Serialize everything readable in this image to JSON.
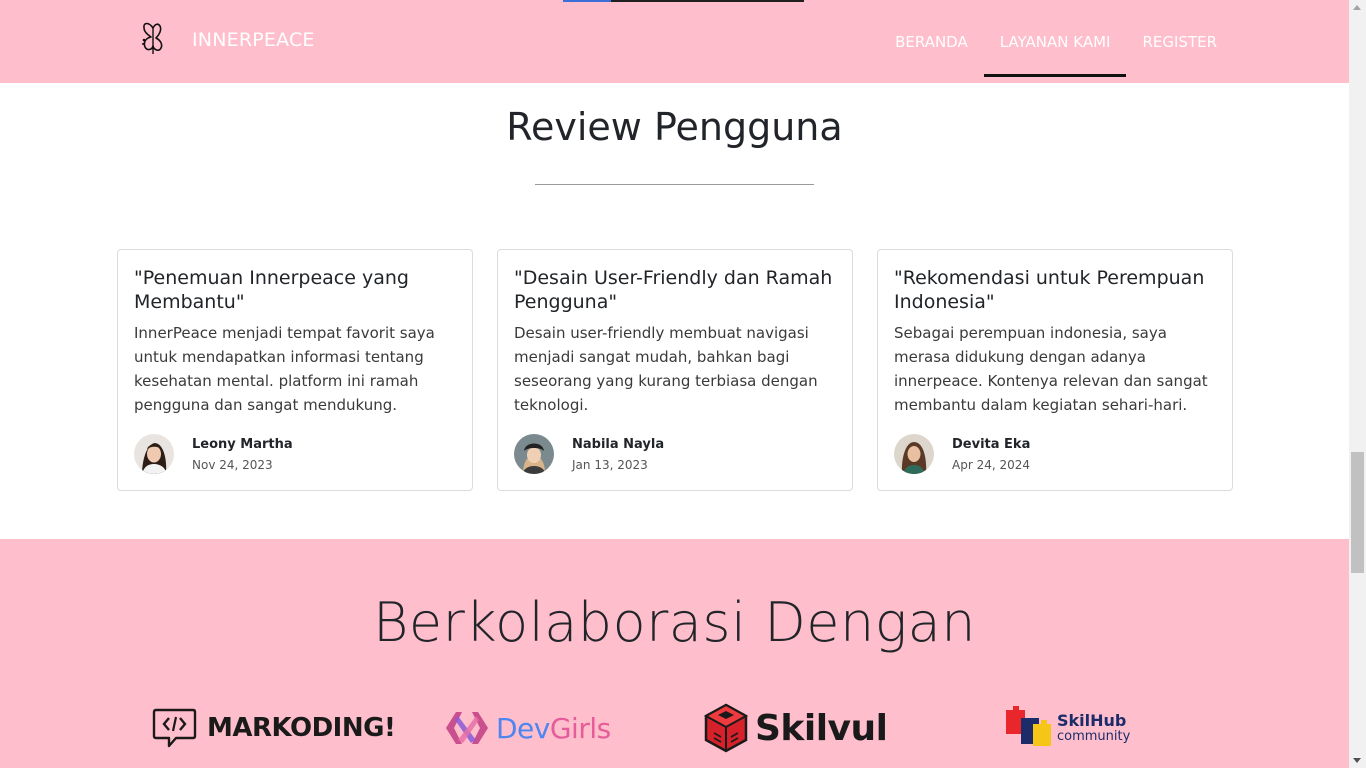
{
  "navbar": {
    "brand": "INNERPEACE",
    "links": [
      {
        "label": "BERANDA",
        "active": false
      },
      {
        "label": "LAYANAN KAMI",
        "active": true
      },
      {
        "label": "REGISTER",
        "active": false
      }
    ]
  },
  "reviews": {
    "title": "Review Pengguna",
    "items": [
      {
        "title": "\"Penemuan Innerpeace yang Membantu\"",
        "text": "InnerPeace menjadi tempat favorit saya untuk mendapatkan informasi tentang kesehatan mental. platform ini ramah pengguna dan sangat mendukung.",
        "name": "Leony Martha",
        "date": "Nov 24, 2023"
      },
      {
        "title": "\"Desain User-Friendly dan Ramah Pengguna\"",
        "text": "Desain user-friendly membuat navigasi menjadi sangat mudah, bahkan bagi seseorang yang kurang terbiasa dengan teknologi.",
        "name": "Nabila Nayla",
        "date": "Jan 13, 2023"
      },
      {
        "title": "\"Rekomendasi untuk Perempuan Indonesia\"",
        "text": "Sebagai perempuan indonesia, saya merasa didukung dengan adanya innerpeace. Kontenya relevan dan sangat membantu dalam kegiatan sehari-hari.",
        "name": "Devita Eka",
        "date": "Apr 24, 2024"
      }
    ]
  },
  "collab": {
    "title": "Berkolaborasi Dengan",
    "logos": {
      "markoding": "MARKODING!",
      "devgirls_a": "Dev",
      "devgirls_b": "Girls",
      "skilvul": "Skilvul",
      "skilhub_main": "SkilHub",
      "skilhub_sub": "community"
    }
  },
  "colors": {
    "pink": "#FFBECC",
    "text": "#212529"
  }
}
